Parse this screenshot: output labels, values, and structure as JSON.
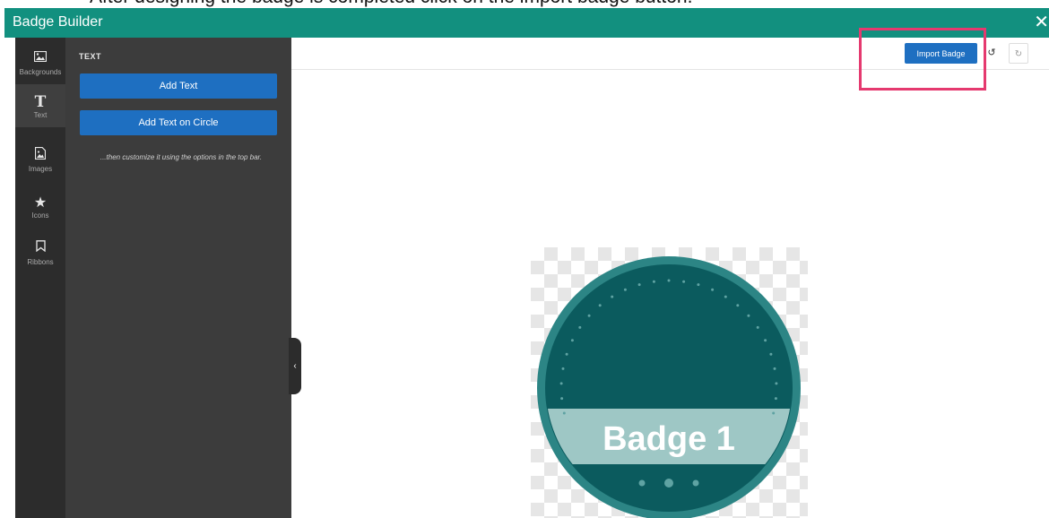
{
  "instruction": {
    "text": "After designing the badge is completed click on the import badge button."
  },
  "window": {
    "title": "Badge Builder",
    "close_glyph": "✕"
  },
  "iconbar": {
    "items": [
      {
        "label": "Backgrounds",
        "icon": "image-icon",
        "glyph": "🖼"
      },
      {
        "label": "Text",
        "icon": "text-icon",
        "glyph": "T"
      },
      {
        "label": "Images",
        "icon": "file-image-icon",
        "glyph": "🗎"
      },
      {
        "label": "Icons",
        "icon": "star-icon",
        "glyph": "★"
      },
      {
        "label": "Ribbons",
        "icon": "bookmark-icon",
        "glyph": "⛉"
      }
    ]
  },
  "panel": {
    "heading": "TEXT",
    "add_text_label": "Add Text",
    "add_text_circle_label": "Add Text on Circle",
    "hint": "...then customize it using the options in the top bar."
  },
  "collapse_glyph": "‹",
  "toolbar": {
    "import_label": "Import Badge",
    "undo_glyph": "↺",
    "redo_glyph": "↻"
  },
  "badge": {
    "text": "Badge 1"
  },
  "colors": {
    "teal": "#12907f",
    "badge_dark": "#0b5b5e",
    "badge_ring": "#2c8585",
    "band": "#9ec7c5",
    "primary": "#1e6fc1",
    "highlight": "#e5396f"
  }
}
